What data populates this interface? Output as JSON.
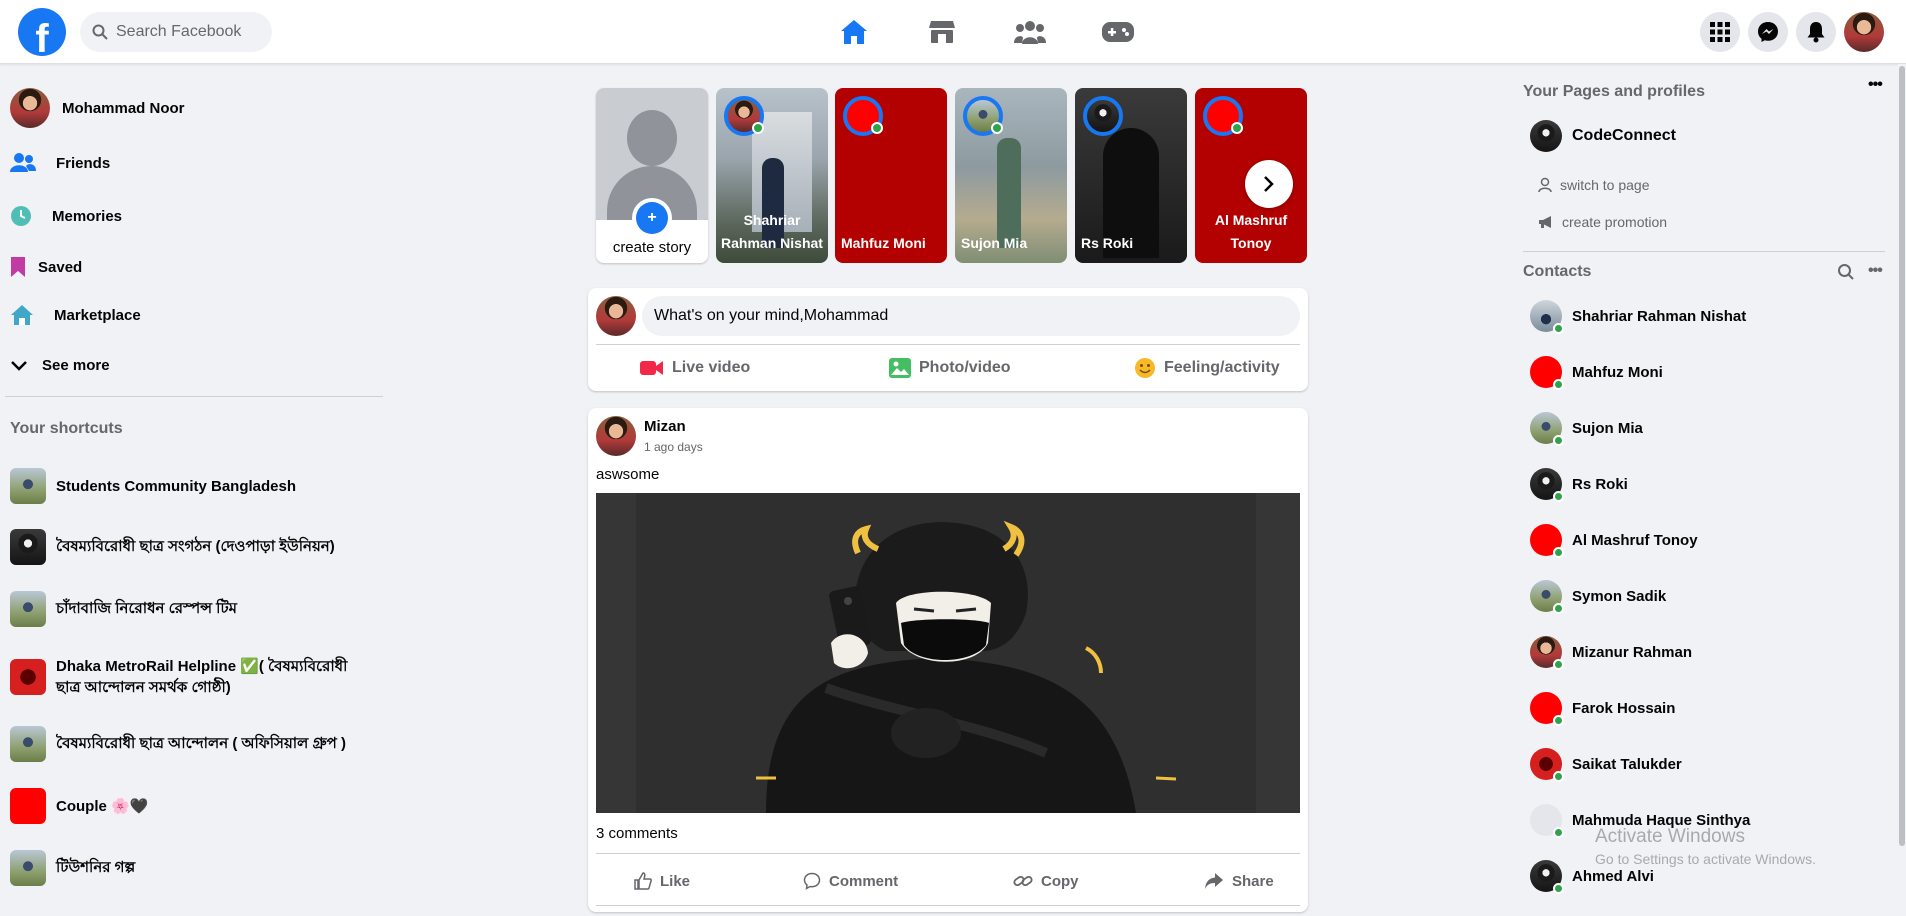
{
  "search": {
    "placeholder": "Search Facebook"
  },
  "profile": {
    "name": "Mohammad Noor"
  },
  "left_menu": [
    {
      "label": "Friends",
      "icon": "friends-icon"
    },
    {
      "label": "Memories",
      "icon": "clock-icon"
    },
    {
      "label": "Saved",
      "icon": "bookmark-icon"
    },
    {
      "label": "Marketplace",
      "icon": "marketplace-icon"
    },
    {
      "label": "See more",
      "icon": "chevron-down-icon"
    }
  ],
  "shortcuts": {
    "title": "Your shortcuts",
    "items": [
      {
        "label": "Students Community Bangladesh"
      },
      {
        "label": "বৈষম্যবিরোধী ছাত্র সংগঠন (দেওপাড়া ইউনিয়ন)"
      },
      {
        "label": "চাঁদাবাজি নিরোধন রেস্পন্স টিম"
      },
      {
        "label": "Dhaka MetroRail Helpline ✅( বৈষম্যবিরোধী ছাত্র আন্দোলন সমর্থক গোষ্ঠী)"
      },
      {
        "label": "বৈষম্যবিরোধী ছাত্র আন্দোলন ( অফিসিয়াল গ্রুপ )"
      },
      {
        "label": "Couple 🌸🖤"
      },
      {
        "label": "টিউশনির গল্প"
      }
    ]
  },
  "stories": {
    "create_label": "create story",
    "items": [
      {
        "name": "Shahriar Rahman Nishat"
      },
      {
        "name": "Mahfuz Moni"
      },
      {
        "name": "Sujon Mia"
      },
      {
        "name": "Rs Roki"
      },
      {
        "name": "Al Mashruf Tonoy"
      }
    ]
  },
  "composer": {
    "placeholder": "What's on your mind,Mohammad",
    "live_label": "Live video",
    "photo_label": "Photo/video",
    "feeling_label": "Feeling/activity"
  },
  "post": {
    "author": "Mizan",
    "time": "1 ago days",
    "text": "aswsome",
    "comments": "3 comments",
    "like_label": "Like",
    "comment_label": "Comment",
    "copy_label": "Copy",
    "share_label": "Share"
  },
  "right": {
    "pages_title": "Your Pages and profiles",
    "page_name": "CodeConnect",
    "switch_label": "switch to page",
    "promo_label": "create promotion",
    "contacts_title": "Contacts",
    "contacts": [
      {
        "name": "Shahriar Rahman Nishat"
      },
      {
        "name": "Mahfuz Moni"
      },
      {
        "name": "Sujon Mia"
      },
      {
        "name": "Rs Roki"
      },
      {
        "name": "Al Mashruf Tonoy"
      },
      {
        "name": "Symon Sadik"
      },
      {
        "name": "Mizanur Rahman"
      },
      {
        "name": "Farok Hossain"
      },
      {
        "name": "Saikat Talukder"
      },
      {
        "name": "Mahmuda Haque Sinthya"
      },
      {
        "name": "Ahmed Alvi"
      }
    ]
  },
  "watermark": {
    "line1": "Activate Windows",
    "line2": "Go to Settings to activate Windows."
  },
  "colors": {
    "brand": "#1877f2",
    "online": "#31a24c",
    "story_red": "#b30000",
    "background": "#f0f2f5"
  }
}
